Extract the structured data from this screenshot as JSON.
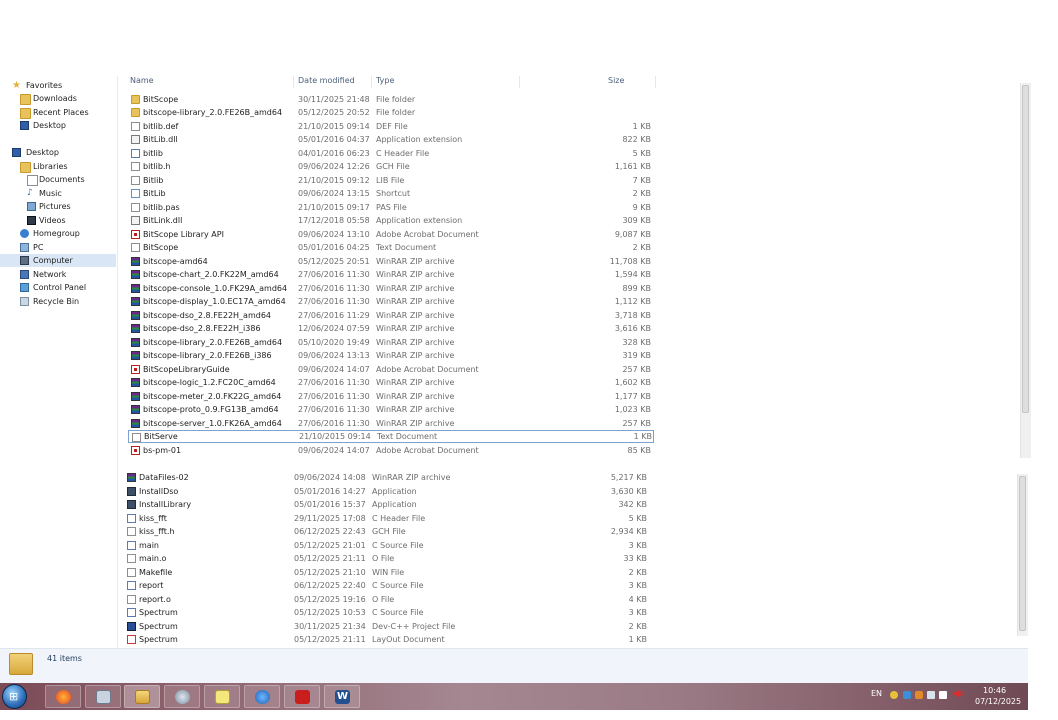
{
  "nav": {
    "favorites": "Favorites",
    "downloads": "Downloads",
    "recent_places": "Recent Places",
    "desktop_fav": "Desktop",
    "desktop": "Desktop",
    "libraries": "Libraries",
    "documents": "Documents",
    "music": "Music",
    "pictures": "Pictures",
    "videos": "Videos",
    "homegroup": "Homegroup",
    "pc": "PC",
    "computer": "Computer",
    "network": "Network",
    "control_panel": "Control Panel",
    "recycle_bin": "Recycle Bin"
  },
  "columns": {
    "name": "Name",
    "date": "Date modified",
    "type": "Type",
    "size": "Size"
  },
  "files_top": [
    {
      "name": "BitScope",
      "date": "30/11/2025 21:48",
      "type": "File folder",
      "size": "",
      "icon": "folder"
    },
    {
      "name": "bitscope-library_2.0.FE26B_amd64",
      "date": "05/12/2025 20:52",
      "type": "File folder",
      "size": "",
      "icon": "folder"
    },
    {
      "name": "bitlib.def",
      "date": "21/10/2015 09:14",
      "type": "DEF File",
      "size": "1 KB",
      "icon": "doc"
    },
    {
      "name": "BitLib.dll",
      "date": "05/01/2016 04:37",
      "type": "Application extension",
      "size": "822 KB",
      "icon": "dll"
    },
    {
      "name": "bitlib",
      "date": "04/01/2016 06:23",
      "type": "C Header File",
      "size": "5 KB",
      "icon": "hdr"
    },
    {
      "name": "bitlib.h",
      "date": "09/06/2024 12:26",
      "type": "GCH File",
      "size": "1,161 KB",
      "icon": "doc"
    },
    {
      "name": "Bitlib",
      "date": "21/10/2015 09:12",
      "type": "LIB File",
      "size": "7 KB",
      "icon": "doc"
    },
    {
      "name": "BitLib",
      "date": "09/06/2024 13:15",
      "type": "Shortcut",
      "size": "2 KB",
      "icon": "lnk"
    },
    {
      "name": "bitlib.pas",
      "date": "21/10/2015 09:17",
      "type": "PAS File",
      "size": "9 KB",
      "icon": "doc"
    },
    {
      "name": "BitLink.dll",
      "date": "17/12/2018 05:58",
      "type": "Application extension",
      "size": "309 KB",
      "icon": "dll"
    },
    {
      "name": "BitScope Library API",
      "date": "09/06/2024 13:10",
      "type": "Adobe Acrobat Document",
      "size": "9,087 KB",
      "icon": "pdf"
    },
    {
      "name": "BitScope",
      "date": "05/01/2016 04:25",
      "type": "Text Document",
      "size": "2 KB",
      "icon": "doc"
    },
    {
      "name": "bitscope-amd64",
      "date": "05/12/2025 20:51",
      "type": "WinRAR ZIP archive",
      "size": "11,708 KB",
      "icon": "zip"
    },
    {
      "name": "bitscope-chart_2.0.FK22M_amd64",
      "date": "27/06/2016 11:30",
      "type": "WinRAR ZIP archive",
      "size": "1,594 KB",
      "icon": "zip"
    },
    {
      "name": "bitscope-console_1.0.FK29A_amd64",
      "date": "27/06/2016 11:30",
      "type": "WinRAR ZIP archive",
      "size": "899 KB",
      "icon": "zip"
    },
    {
      "name": "bitscope-display_1.0.EC17A_amd64",
      "date": "27/06/2016 11:30",
      "type": "WinRAR ZIP archive",
      "size": "1,112 KB",
      "icon": "zip"
    },
    {
      "name": "bitscope-dso_2.8.FE22H_amd64",
      "date": "27/06/2016 11:29",
      "type": "WinRAR ZIP archive",
      "size": "3,718 KB",
      "icon": "zip"
    },
    {
      "name": "bitscope-dso_2.8.FE22H_i386",
      "date": "12/06/2024 07:59",
      "type": "WinRAR ZIP archive",
      "size": "3,616 KB",
      "icon": "zip"
    },
    {
      "name": "bitscope-library_2.0.FE26B_amd64",
      "date": "05/10/2020 19:49",
      "type": "WinRAR ZIP archive",
      "size": "328 KB",
      "icon": "zip"
    },
    {
      "name": "bitscope-library_2.0.FE26B_i386",
      "date": "09/06/2024 13:13",
      "type": "WinRAR ZIP archive",
      "size": "319 KB",
      "icon": "zip"
    },
    {
      "name": "BitScopeLibraryGuide",
      "date": "09/06/2024 14:07",
      "type": "Adobe Acrobat Document",
      "size": "257 KB",
      "icon": "pdf"
    },
    {
      "name": "bitscope-logic_1.2.FC20C_amd64",
      "date": "27/06/2016 11:30",
      "type": "WinRAR ZIP archive",
      "size": "1,602 KB",
      "icon": "zip"
    },
    {
      "name": "bitscope-meter_2.0.FK22G_amd64",
      "date": "27/06/2016 11:30",
      "type": "WinRAR ZIP archive",
      "size": "1,177 KB",
      "icon": "zip"
    },
    {
      "name": "bitscope-proto_0.9.FG13B_amd64",
      "date": "27/06/2016 11:30",
      "type": "WinRAR ZIP archive",
      "size": "1,023 KB",
      "icon": "zip"
    },
    {
      "name": "bitscope-server_1.0.FK26A_amd64",
      "date": "27/06/2016 11:30",
      "type": "WinRAR ZIP archive",
      "size": "257 KB",
      "icon": "zip"
    },
    {
      "name": "BitServe",
      "date": "21/10/2015 09:14",
      "type": "Text Document",
      "size": "1 KB",
      "icon": "doc"
    },
    {
      "name": "bs-pm-01",
      "date": "09/06/2024 14:07",
      "type": "Adobe Acrobat Document",
      "size": "85 KB",
      "icon": "pdf"
    }
  ],
  "files_bottom": [
    {
      "name": "DataFiles-02",
      "date": "09/06/2024 14:08",
      "type": "WinRAR ZIP archive",
      "size": "5,217 KB",
      "icon": "zip"
    },
    {
      "name": "InstallDso",
      "date": "05/01/2016 14:27",
      "type": "Application",
      "size": "3,630 KB",
      "icon": "exe"
    },
    {
      "name": "InstallLibrary",
      "date": "05/01/2016 15:37",
      "type": "Application",
      "size": "342 KB",
      "icon": "exe"
    },
    {
      "name": "kiss_fft",
      "date": "29/11/2025 17:08",
      "type": "C Header File",
      "size": "5 KB",
      "icon": "hdr"
    },
    {
      "name": "kiss_fft.h",
      "date": "06/12/2025 22:43",
      "type": "GCH File",
      "size": "2,934 KB",
      "icon": "doc"
    },
    {
      "name": "main",
      "date": "05/12/2025 21:01",
      "type": "C Source File",
      "size": "3 KB",
      "icon": "hdr"
    },
    {
      "name": "main.o",
      "date": "05/12/2025 21:11",
      "type": "O File",
      "size": "33 KB",
      "icon": "doc"
    },
    {
      "name": "Makefile",
      "date": "05/12/2025 21:10",
      "type": "WIN File",
      "size": "2 KB",
      "icon": "doc"
    },
    {
      "name": "report",
      "date": "06/12/2025 22:40",
      "type": "C Source File",
      "size": "3 KB",
      "icon": "hdr"
    },
    {
      "name": "report.o",
      "date": "05/12/2025 19:16",
      "type": "O File",
      "size": "4 KB",
      "icon": "doc"
    },
    {
      "name": "Spectrum",
      "date": "05/12/2025 10:53",
      "type": "C Source File",
      "size": "3 KB",
      "icon": "hdr"
    },
    {
      "name": "Spectrum",
      "date": "30/11/2025 21:34",
      "type": "Dev-C++ Project File",
      "size": "2 KB",
      "icon": "dev"
    },
    {
      "name": "Spectrum",
      "date": "05/12/2025 21:11",
      "type": "LayOut Document",
      "size": "1 KB",
      "icon": "lay"
    }
  ],
  "status": {
    "items": "41 items"
  },
  "tray": {
    "lang": "EN",
    "time": "10:46",
    "date": "07/12/2025"
  },
  "colors": {
    "selection": "#d9e6f5",
    "header_text": "#4c607a"
  }
}
